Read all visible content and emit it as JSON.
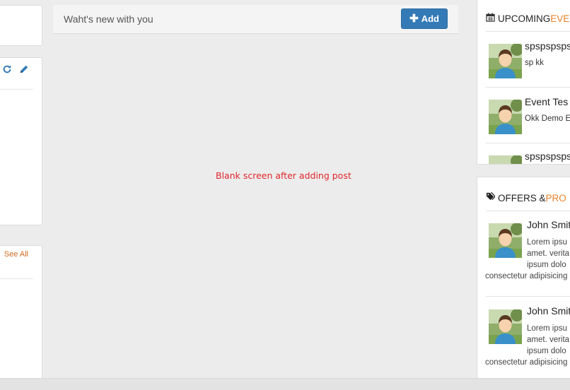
{
  "left": {
    "see_all_label": "See All"
  },
  "post": {
    "placeholder": "Waht's new with you",
    "add_label": "Add"
  },
  "annotation": "Blank screen after adding post",
  "events": {
    "heading_main": "UPCOMING ",
    "heading_accent": "EVE",
    "items": [
      {
        "title": "spspspsps",
        "sub": "sp kk"
      },
      {
        "title": "Event Tes",
        "sub": "Okk Demo E"
      },
      {
        "title": "spspspsps",
        "sub": ""
      }
    ]
  },
  "offers": {
    "heading_main": "OFFERS & ",
    "heading_accent": "PRO",
    "items": [
      {
        "name": "John Smit",
        "line1": "Lorem ipsu",
        "line2": "amet. verita",
        "line3": "ipsum dolo",
        "line4": "consectetur adipisicing"
      },
      {
        "name": "John Smit",
        "line1": "Lorem ipsu",
        "line2": "amet. verita",
        "line3": "ipsum dolo",
        "line4": "consectetur adipisicing"
      }
    ]
  },
  "colors": {
    "primary": "#337ab7",
    "accent": "#e8822a",
    "annotation": "#e0242b",
    "link": "#d2691e"
  }
}
